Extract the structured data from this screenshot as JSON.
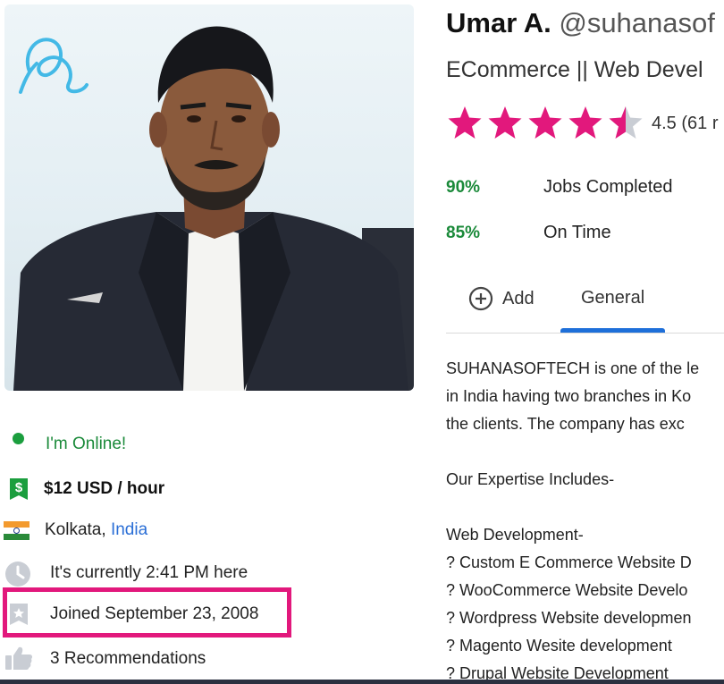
{
  "profile": {
    "name": "Umar A.",
    "handle": "@suhanasof",
    "tagline": "ECommerce || Web Devel",
    "rating_text": "4.5 (61 r",
    "rating": 4.5,
    "rating_max": 5,
    "star_color": "#e2187c"
  },
  "stats": [
    {
      "pct": "90%",
      "label": "Jobs Completed"
    },
    {
      "pct": "85%",
      "label": "On Time"
    }
  ],
  "tabs": {
    "add_label": "Add",
    "general_label": "General"
  },
  "details": {
    "online": "I'm Online!",
    "rate": "$12 USD / hour",
    "city": "Kolkata, ",
    "country": "India",
    "local_time": "It's currently 2:41 PM here",
    "joined": "Joined September 23, 2008",
    "recommendations": "3 Recommendations"
  },
  "description": [
    "SUHANASOFTECH is one of the le",
    "in India having two branches in Ko",
    "the clients. The company has exc",
    "",
    "Our Expertise Includes-",
    "",
    "Web Development-",
    "? Custom E Commerce Website D",
    "? WooCommerce Website Develo",
    "? Wordpress Website developmen",
    "? Magento Wesite development",
    "? Drupal Website Development"
  ],
  "colors": {
    "accent_green": "#1b8a3a",
    "highlight_pink": "#e2187c",
    "link_blue": "#2b6fd6",
    "tab_underline": "#1e6fd9"
  }
}
